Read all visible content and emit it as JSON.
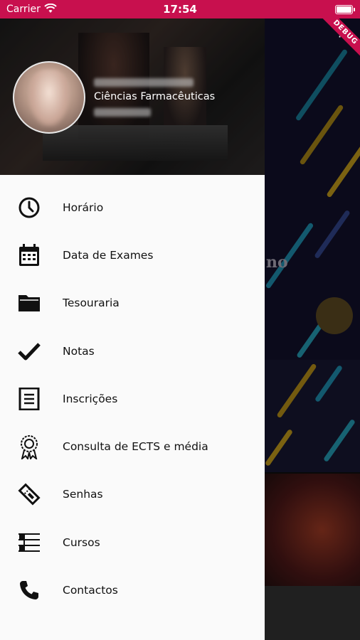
{
  "status_bar": {
    "carrier": "Carrier",
    "time": "17:54"
  },
  "profile": {
    "course": "Ciências Farmacêuticas"
  },
  "menu": {
    "items": [
      {
        "label": "Horário",
        "icon": "clock-icon"
      },
      {
        "label": "Data de Exames",
        "icon": "calendar-icon"
      },
      {
        "label": "Tesouraria",
        "icon": "folder-icon"
      },
      {
        "label": "Notas",
        "icon": "checkmark-icon"
      },
      {
        "label": "Inscrições",
        "icon": "document-icon"
      },
      {
        "label": "Consulta de ECTS e média",
        "icon": "award-ribbon-icon"
      },
      {
        "label": "Senhas",
        "icon": "ticket-icon"
      },
      {
        "label": "Cursos",
        "icon": "list-icon"
      },
      {
        "label": "Contactos",
        "icon": "phone-icon"
      }
    ]
  },
  "background": {
    "debug_banner": "DEBUG",
    "partial_text": "no"
  },
  "colors": {
    "status_bar": "#c8104e",
    "drawer_bg": "#fafafa",
    "icon": "#111111"
  }
}
